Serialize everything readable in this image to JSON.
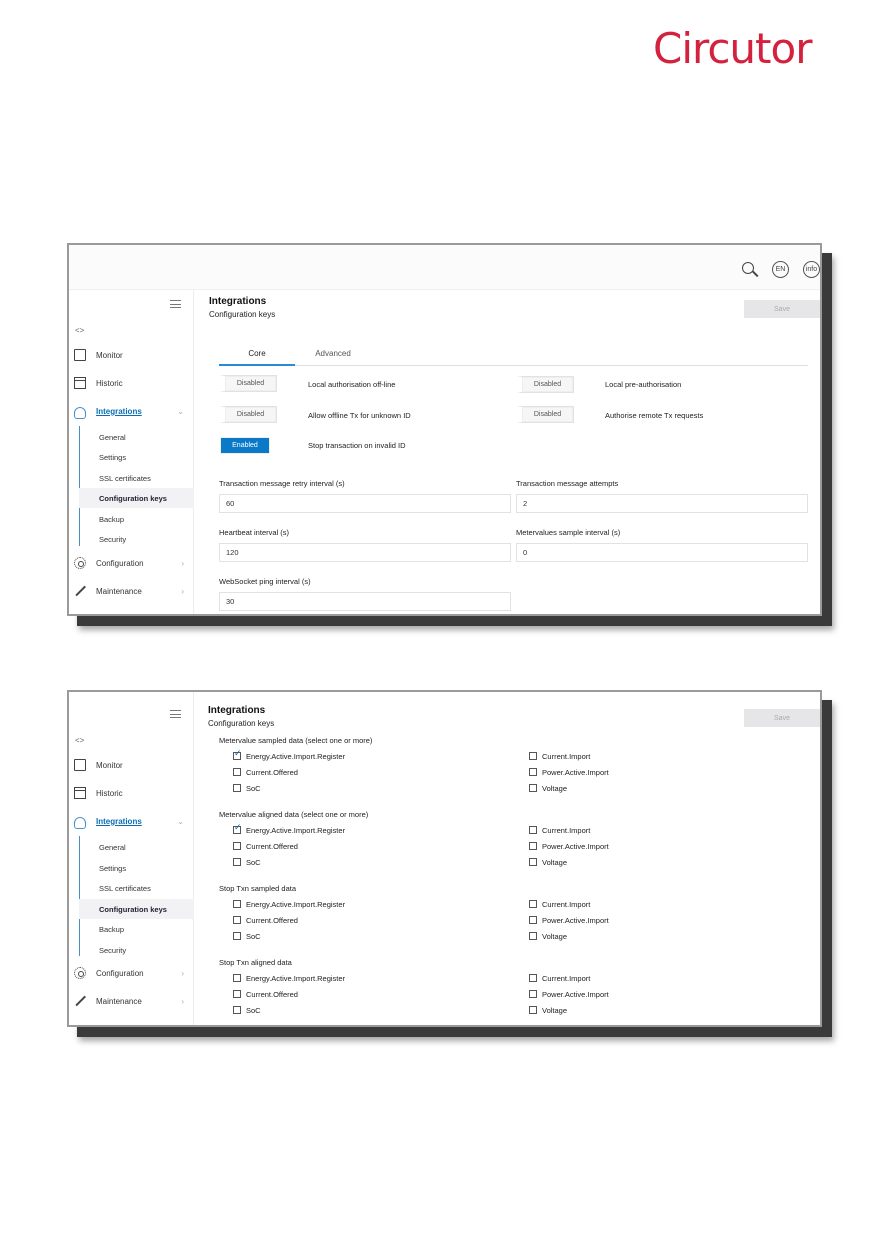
{
  "brand": {
    "logo_text": "Circutor",
    "color": "#d4213d"
  },
  "topbar": {
    "lang": "EN",
    "info": "info"
  },
  "sidebar": {
    "items": [
      {
        "label": "Monitor"
      },
      {
        "label": "Historic"
      },
      {
        "label": "Integrations"
      },
      {
        "label": "Configuration"
      },
      {
        "label": "Maintenance"
      }
    ],
    "sub_items": [
      {
        "label": "General"
      },
      {
        "label": "Settings"
      },
      {
        "label": "SSL certificates"
      },
      {
        "label": "Configuration keys"
      },
      {
        "label": "Backup"
      },
      {
        "label": "Security"
      }
    ]
  },
  "header": {
    "title": "Integrations",
    "subtitle": "Configuration keys",
    "save_label": "Save"
  },
  "tabs": [
    {
      "label": "Core"
    },
    {
      "label": "Advanced"
    }
  ],
  "core": {
    "toggles": [
      {
        "state": "Disabled",
        "label": "Local authorisation off-line"
      },
      {
        "state": "Disabled",
        "label": "Allow offline Tx for unknown ID"
      },
      {
        "state": "Enabled",
        "label": "Stop transaction on invalid ID"
      },
      {
        "state": "Disabled",
        "label": "Local pre-authorisation"
      },
      {
        "state": "Disabled",
        "label": "Authorise remote Tx requests"
      }
    ],
    "fields": [
      {
        "label": "Transaction message retry interval (s)",
        "value": "60"
      },
      {
        "label": "Transaction message attempts",
        "value": "2"
      },
      {
        "label": "Heartbeat interval (s)",
        "value": "120"
      },
      {
        "label": "Metervalues sample interval (s)",
        "value": "0"
      },
      {
        "label": "WebSocket ping interval (s)",
        "value": "30"
      }
    ]
  },
  "advanced": {
    "sections": [
      {
        "title": "Metervalue sampled data (select one or more)",
        "options": [
          {
            "label": "Energy.Active.Import.Register",
            "checked": true
          },
          {
            "label": "Current.Offered",
            "checked": false
          },
          {
            "label": "SoC",
            "checked": false
          },
          {
            "label": "Current.Import",
            "checked": false
          },
          {
            "label": "Power.Active.Import",
            "checked": false
          },
          {
            "label": "Voltage",
            "checked": false
          }
        ]
      },
      {
        "title": "Metervalue aligned data (select one or more)",
        "options": [
          {
            "label": "Energy.Active.Import.Register",
            "checked": true
          },
          {
            "label": "Current.Offered",
            "checked": false
          },
          {
            "label": "SoC",
            "checked": false
          },
          {
            "label": "Current.Import",
            "checked": false
          },
          {
            "label": "Power.Active.Import",
            "checked": false
          },
          {
            "label": "Voltage",
            "checked": false
          }
        ]
      },
      {
        "title": "Stop Txn sampled data",
        "options": [
          {
            "label": "Energy.Active.Import.Register",
            "checked": false
          },
          {
            "label": "Current.Offered",
            "checked": false
          },
          {
            "label": "SoC",
            "checked": false
          },
          {
            "label": "Current.Import",
            "checked": false
          },
          {
            "label": "Power.Active.Import",
            "checked": false
          },
          {
            "label": "Voltage",
            "checked": false
          }
        ]
      },
      {
        "title": "Stop Txn aligned data",
        "options": [
          {
            "label": "Energy.Active.Import.Register",
            "checked": false
          },
          {
            "label": "Current.Offered",
            "checked": false
          },
          {
            "label": "SoC",
            "checked": false
          },
          {
            "label": "Current.Import",
            "checked": false
          },
          {
            "label": "Power.Active.Import",
            "checked": false
          },
          {
            "label": "Voltage",
            "checked": false
          }
        ]
      }
    ]
  }
}
